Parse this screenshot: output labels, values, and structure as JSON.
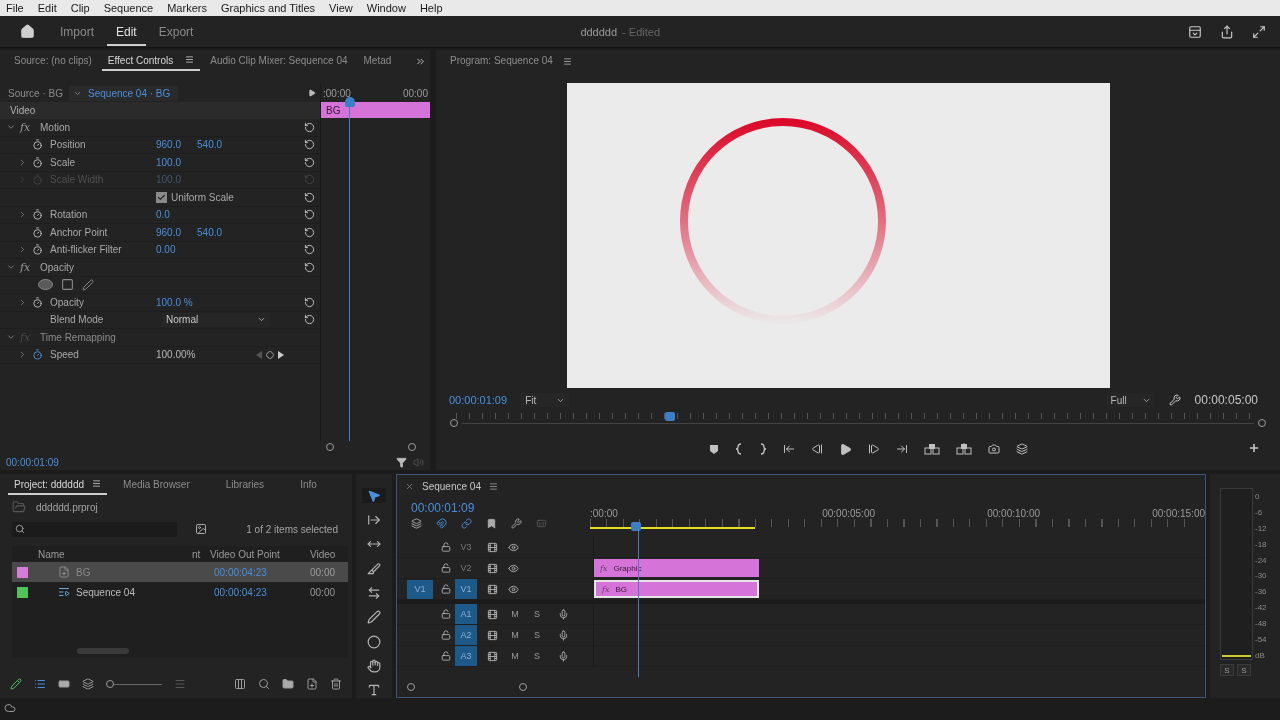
{
  "menu_bar": [
    "File",
    "Edit",
    "Clip",
    "Sequence",
    "Markers",
    "Graphics and Titles",
    "View",
    "Window",
    "Help"
  ],
  "workspace_tabs": [
    {
      "label": "Import",
      "selected": false
    },
    {
      "label": "Edit",
      "selected": true
    },
    {
      "label": "Export",
      "selected": false
    }
  ],
  "document": {
    "name": "dddddd",
    "status": "- Edited"
  },
  "source_tabs": [
    {
      "label": "Source: (no clips)",
      "selected": false
    },
    {
      "label": "Effect Controls",
      "selected": true
    },
    {
      "label": "Audio Clip Mixer: Sequence 04",
      "selected": false
    },
    {
      "label": "Metad",
      "selected": false
    }
  ],
  "effect_controls": {
    "source": "Source · BG",
    "sequence": "Sequence 04 · BG",
    "section": "Video",
    "ruler": [
      ":00:00",
      "00:00"
    ],
    "clip": "BG",
    "timecode": "00:00:01:09",
    "rows": [
      {
        "kind": "group",
        "badge": "fx",
        "label": "Motion",
        "expanded": true,
        "disabled": false
      },
      {
        "kind": "property",
        "label": "Position",
        "values": [
          "960.0",
          "540.0"
        ],
        "expandable": false,
        "disabled": false
      },
      {
        "kind": "property",
        "label": "Scale",
        "values": [
          "100.0"
        ],
        "expandable": true,
        "disabled": false
      },
      {
        "kind": "property",
        "label": "Scale Width",
        "values": [
          "100.0"
        ],
        "expandable": true,
        "disabled": true
      },
      {
        "kind": "checkbox",
        "label": "Uniform Scale",
        "checked": true
      },
      {
        "kind": "property",
        "label": "Rotation",
        "values": [
          "0.0"
        ],
        "expandable": true,
        "disabled": false
      },
      {
        "kind": "property",
        "label": "Anchor Point",
        "values": [
          "960.0",
          "540.0"
        ],
        "expandable": false,
        "disabled": false
      },
      {
        "kind": "property",
        "label": "Anti-flicker Filter",
        "values": [
          "0.00"
        ],
        "expandable": true,
        "disabled": false
      },
      {
        "kind": "group",
        "badge": "fx",
        "label": "Opacity",
        "expanded": true,
        "disabled": false
      },
      {
        "kind": "masks"
      },
      {
        "kind": "property",
        "label": "Opacity",
        "values": [
          "100.0 %"
        ],
        "expandable": true,
        "disabled": false
      },
      {
        "kind": "dropdown",
        "label": "Blend Mode",
        "value": "Normal"
      },
      {
        "kind": "group",
        "badge": "fx",
        "label": "Time Remapping",
        "expanded": true,
        "disabled": true
      },
      {
        "kind": "keyframe",
        "label": "Speed",
        "value": "100.00%"
      }
    ]
  },
  "program_monitor": {
    "title": "Program: Sequence 04",
    "timecode": "00:00:01:09",
    "zoom": "Fit",
    "quality": "Full",
    "duration": "00:00:05:00",
    "playhead": {
      "level": 0.27
    },
    "transport": [
      {
        "kind": "marker"
      },
      {
        "kind": "mark-in"
      },
      {
        "kind": "mark-out"
      },
      {
        "kind": "go-to-in"
      },
      {
        "kind": "step-back"
      },
      {
        "kind": "play"
      },
      {
        "kind": "step-forward"
      },
      {
        "kind": "go-to-out"
      },
      {
        "kind": "insert"
      },
      {
        "kind": "overwrite"
      },
      {
        "kind": "export-frame"
      },
      {
        "kind": "compare"
      }
    ]
  },
  "project": {
    "tabs": [
      {
        "label": "Project: dddddd",
        "selected": true
      },
      {
        "label": "Media Browser",
        "selected": false
      },
      {
        "label": "Libraries",
        "selected": false
      },
      {
        "label": "Info",
        "selected": false
      }
    ],
    "file": "dddddd.prproj",
    "icon_size": {
      "level": 0
    },
    "selection_count": "1 of 2 items selected",
    "columns": [
      "Name",
      "nt",
      "Video Out Point",
      "Video"
    ],
    "items": [
      {
        "kind": "graphic",
        "name": "BG",
        "color": "#d87ad8",
        "video_out_point": "00:00:04:23",
        "column_4": "00:00",
        "selected": true
      },
      {
        "kind": "sequence",
        "name": "Sequence 04",
        "color": "#4ec45a",
        "video_out_point": "00:00:04:23",
        "column_4": "00:00",
        "selected": false
      }
    ]
  },
  "tools": [
    {
      "kind": "selection",
      "selected": true
    },
    {
      "kind": "track-select",
      "selected": false
    },
    {
      "kind": "ripple",
      "selected": false
    },
    {
      "kind": "razor",
      "selected": false
    },
    {
      "kind": "slip",
      "selected": false
    },
    {
      "kind": "pen",
      "selected": false
    },
    {
      "kind": "ellipse",
      "selected": false
    },
    {
      "kind": "hand",
      "selected": false
    },
    {
      "kind": "type",
      "selected": false
    }
  ],
  "timeline": {
    "title": "Sequence 04",
    "timecode": "00:00:01:09",
    "ruler": [
      ":00:00",
      "00:00:05:00",
      "00:00:10:00",
      "00:00:15:00"
    ],
    "video_tracks": [
      {
        "name": "V3",
        "targeted": false
      },
      {
        "name": "V2",
        "targeted": false,
        "clip": {
          "label": "Graphic",
          "badge": "fx",
          "selected": false
        }
      },
      {
        "name": "V1",
        "targeted": true,
        "source_patch": "V1",
        "clip": {
          "label": "BG",
          "badge": "fx",
          "selected": true
        }
      }
    ],
    "audio_tracks": [
      {
        "name": "A1",
        "targeted": true,
        "mute": "M",
        "solo": "S"
      },
      {
        "name": "A2",
        "targeted": true,
        "mute": "M",
        "solo": "S"
      },
      {
        "name": "A3",
        "targeted": true,
        "mute": "M",
        "solo": "S"
      }
    ]
  },
  "audio_meter": {
    "scale": [
      "0",
      "-6",
      "-12",
      "-18",
      "-24",
      "-30",
      "-36",
      "-42",
      "-48",
      "-54",
      "dB"
    ],
    "solo": [
      "S",
      "S"
    ]
  }
}
